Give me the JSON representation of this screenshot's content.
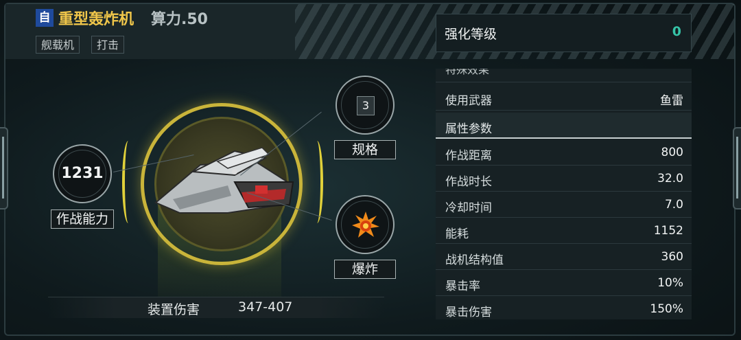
{
  "header": {
    "badge": "自",
    "title": "重型轰炸机",
    "power": "算力.50",
    "tags": [
      "舰载机",
      "打击"
    ]
  },
  "enhance": {
    "label": "强化等级",
    "value": "0"
  },
  "panel": {
    "cut_section": "特殊效果",
    "weapon": {
      "label": "使用武器",
      "value": "鱼雷"
    },
    "attr_section": "属性参数",
    "attributes": [
      {
        "label": "作战距离",
        "value": "800"
      },
      {
        "label": "作战时长",
        "value": "32.0"
      },
      {
        "label": "冷却时间",
        "value": "7.0"
      },
      {
        "label": "能耗",
        "value": "1152"
      },
      {
        "label": "战机结构值",
        "value": "360"
      },
      {
        "label": "暴击率",
        "value": "10%"
      },
      {
        "label": "暴击伤害",
        "value": "150%"
      }
    ]
  },
  "center": {
    "combat": {
      "value": "1231",
      "label": "作战能力"
    },
    "spec": {
      "value": "3",
      "label": "规格"
    },
    "damage_type": {
      "label": "爆炸",
      "icon": "explosion-icon"
    },
    "equip_damage": {
      "label": "装置伤害",
      "value": "347-407"
    }
  },
  "colors": {
    "title": "#f0c64a",
    "accent": "#36c4a8",
    "ring": "#c9b43a",
    "badge": "#1f4a9c"
  }
}
